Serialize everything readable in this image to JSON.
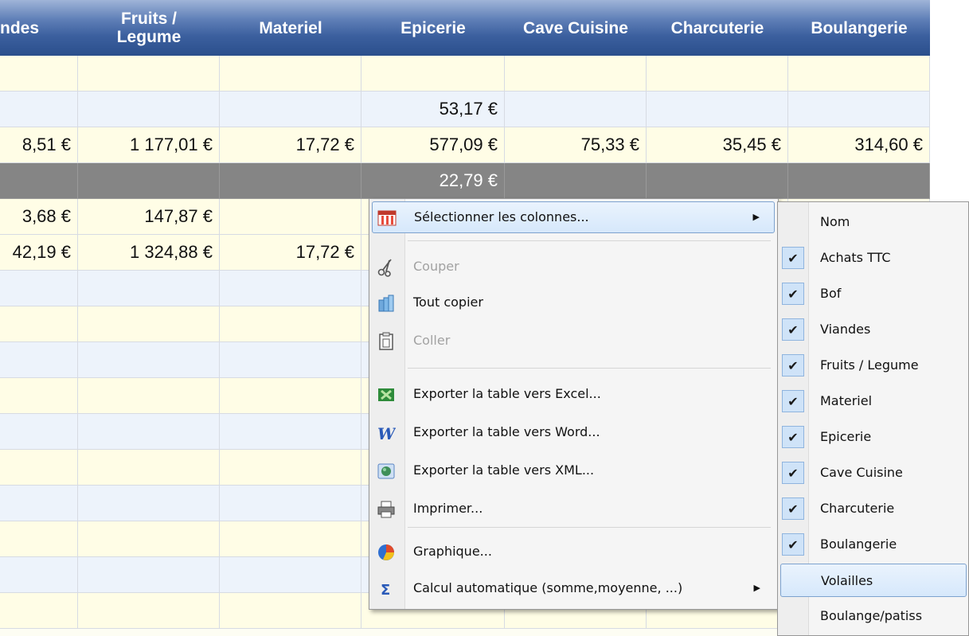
{
  "header": {
    "columns": [
      "ndes",
      "Fruits /\nLegume",
      "Materiel",
      "Epicerie",
      "Cave Cuisine",
      "Charcuterie",
      "Boulangerie"
    ]
  },
  "rows": [
    {
      "style": "cream",
      "cells": [
        "",
        "",
        "",
        "",
        "",
        "",
        ""
      ]
    },
    {
      "style": "blue",
      "cells": [
        "",
        "",
        "",
        "53,17 €",
        "",
        "",
        ""
      ]
    },
    {
      "style": "cream",
      "cells": [
        "8,51 €",
        "1 177,01 €",
        "17,72 €",
        "577,09 €",
        "75,33 €",
        "35,45 €",
        "314,60 €"
      ]
    },
    {
      "style": "dark",
      "cells": [
        "",
        "",
        "",
        "22,79 €",
        "",
        "",
        ""
      ]
    },
    {
      "style": "cream",
      "cells": [
        "3,68 €",
        "147,87 €",
        "",
        "",
        "",
        "",
        ""
      ]
    },
    {
      "style": "cream",
      "cells": [
        "42,19 €",
        "1 324,88 €",
        "17,72 €",
        "",
        "",
        "",
        ""
      ]
    },
    {
      "style": "blue",
      "cells": [
        "",
        "",
        "",
        "",
        "",
        "",
        ""
      ]
    },
    {
      "style": "cream",
      "cells": [
        "",
        "",
        "",
        "",
        "",
        "",
        ""
      ]
    },
    {
      "style": "blue",
      "cells": [
        "",
        "",
        "",
        "",
        "",
        "",
        ""
      ]
    },
    {
      "style": "cream",
      "cells": [
        "",
        "",
        "",
        "",
        "",
        "",
        ""
      ]
    },
    {
      "style": "blue",
      "cells": [
        "",
        "",
        "",
        "",
        "",
        "",
        ""
      ]
    },
    {
      "style": "cream",
      "cells": [
        "",
        "",
        "",
        "",
        "",
        "",
        ""
      ]
    },
    {
      "style": "blue",
      "cells": [
        "",
        "",
        "",
        "",
        "",
        "",
        ""
      ]
    },
    {
      "style": "cream",
      "cells": [
        "",
        "",
        "",
        "",
        "",
        "",
        ""
      ]
    },
    {
      "style": "blue",
      "cells": [
        "",
        "",
        "",
        "",
        "",
        "",
        ""
      ]
    },
    {
      "style": "cream",
      "cells": [
        "",
        "",
        "",
        "",
        "",
        "",
        ""
      ]
    }
  ],
  "context_menu": {
    "items": [
      {
        "label": "Sélectionner les colonnes...",
        "icon": "columns-icon",
        "disabled": false,
        "highlighted": true,
        "submenu": true
      },
      {
        "label": "Couper",
        "icon": "scissors-icon",
        "disabled": true,
        "highlighted": false,
        "submenu": false
      },
      {
        "label": "Tout copier",
        "icon": "copy-icon",
        "disabled": false,
        "highlighted": false,
        "submenu": false
      },
      {
        "label": "Coller",
        "icon": "paste-icon",
        "disabled": true,
        "highlighted": false,
        "submenu": false
      },
      {
        "label": "Exporter la table vers Excel...",
        "icon": "excel-icon",
        "disabled": false,
        "highlighted": false,
        "submenu": false
      },
      {
        "label": "Exporter la table vers Word...",
        "icon": "word-icon",
        "disabled": false,
        "highlighted": false,
        "submenu": false
      },
      {
        "label": "Exporter la table vers XML...",
        "icon": "xml-icon",
        "disabled": false,
        "highlighted": false,
        "submenu": false
      },
      {
        "label": "Imprimer...",
        "icon": "printer-icon",
        "disabled": false,
        "highlighted": false,
        "submenu": false
      },
      {
        "label": "Graphique...",
        "icon": "chart-icon",
        "disabled": false,
        "highlighted": false,
        "submenu": false
      },
      {
        "label": "Calcul automatique (somme,moyenne, ...)",
        "icon": "sigma-icon",
        "disabled": false,
        "highlighted": false,
        "submenu": true
      }
    ]
  },
  "column_submenu": {
    "items": [
      {
        "label": "Nom",
        "checked": false,
        "highlighted": false
      },
      {
        "label": "Achats TTC",
        "checked": true,
        "highlighted": false
      },
      {
        "label": "Bof",
        "checked": true,
        "highlighted": false
      },
      {
        "label": "Viandes",
        "checked": true,
        "highlighted": false
      },
      {
        "label": "Fruits / Legume",
        "checked": true,
        "highlighted": false
      },
      {
        "label": "Materiel",
        "checked": true,
        "highlighted": false
      },
      {
        "label": "Epicerie",
        "checked": true,
        "highlighted": false
      },
      {
        "label": "Cave Cuisine",
        "checked": true,
        "highlighted": false
      },
      {
        "label": "Charcuterie",
        "checked": true,
        "highlighted": false
      },
      {
        "label": "Boulangerie",
        "checked": true,
        "highlighted": false
      },
      {
        "label": "Volailles",
        "checked": false,
        "highlighted": true
      },
      {
        "label": "Boulange/patiss",
        "checked": false,
        "highlighted": false
      }
    ]
  },
  "colors": {
    "header_dark": "#2b4f8c",
    "row_cream": "#fffde6",
    "row_blue": "#edf3fb",
    "row_dark": "#858585",
    "highlight": "#d6e8fb"
  }
}
